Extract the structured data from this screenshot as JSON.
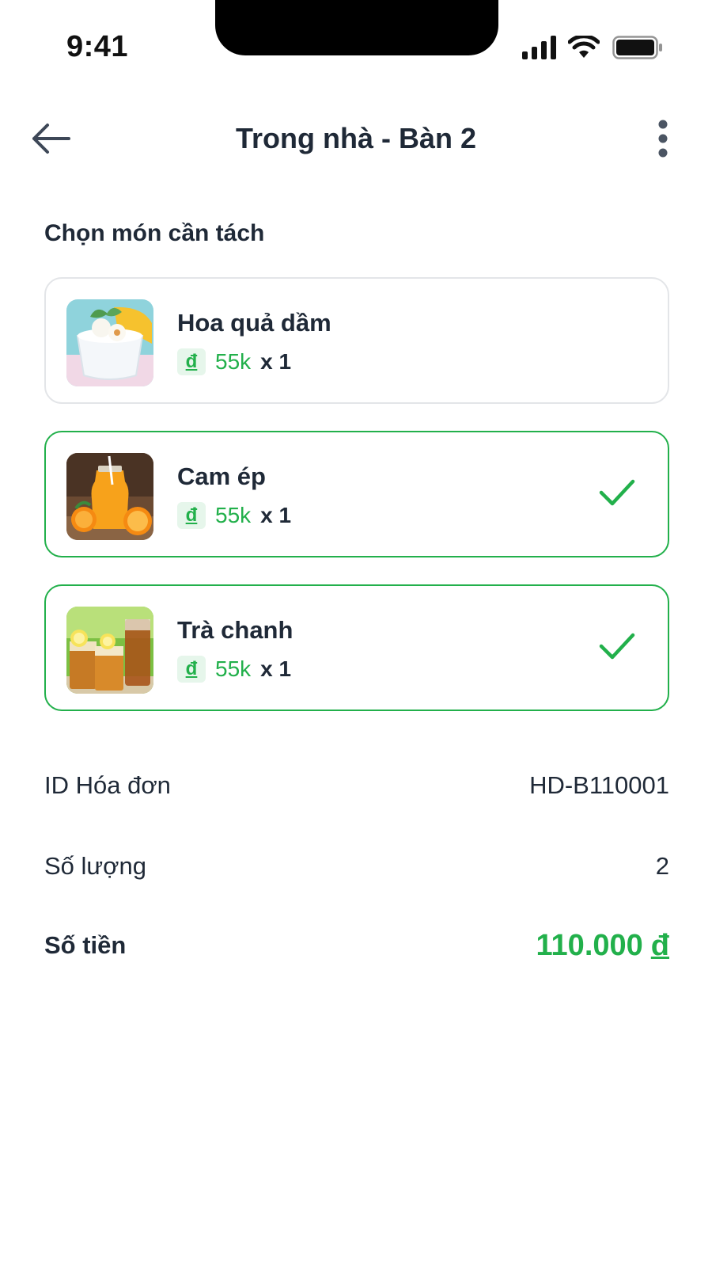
{
  "status_bar": {
    "time": "9:41",
    "icons": [
      "cellular-signal-icon",
      "wifi-icon",
      "battery-icon"
    ]
  },
  "header": {
    "title": "Trong nhà - Bàn 2",
    "back_icon": "arrow-left-icon",
    "more_icon": "more-vertical-icon"
  },
  "section_label": "Chọn món cần tách",
  "items": [
    {
      "name": "Hoa quả dầm",
      "currency": "đ",
      "price": "55k",
      "qty": "x 1",
      "selected": false,
      "thumb_icon": "fruit-yogurt-cup-image"
    },
    {
      "name": "Cam ép",
      "currency": "đ",
      "price": "55k",
      "qty": "x 1",
      "selected": true,
      "thumb_icon": "orange-juice-image"
    },
    {
      "name": "Trà chanh",
      "currency": "đ",
      "price": "55k",
      "qty": "x 1",
      "selected": true,
      "thumb_icon": "lemon-tea-image"
    }
  ],
  "summary": {
    "invoice_label": "ID Hóa đơn",
    "invoice_value": "HD-B110001",
    "qty_label": "Số lượng",
    "qty_value": "2",
    "amount_label": "Số tiền",
    "amount_value": "110.000",
    "amount_currency": "đ"
  },
  "colors": {
    "accent": "#22b04b",
    "text": "#1f2937",
    "border": "#e3e5e8",
    "badge_bg": "#e6f6eb"
  }
}
